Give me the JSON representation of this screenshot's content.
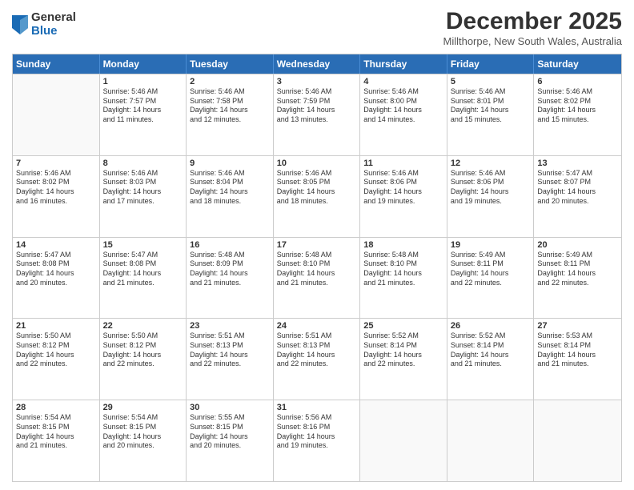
{
  "header": {
    "logo_general": "General",
    "logo_blue": "Blue",
    "title": "December 2025",
    "location": "Millthorpe, New South Wales, Australia"
  },
  "days_of_week": [
    "Sunday",
    "Monday",
    "Tuesday",
    "Wednesday",
    "Thursday",
    "Friday",
    "Saturday"
  ],
  "rows": [
    [
      {
        "day": "",
        "lines": []
      },
      {
        "day": "1",
        "lines": [
          "Sunrise: 5:46 AM",
          "Sunset: 7:57 PM",
          "Daylight: 14 hours",
          "and 11 minutes."
        ]
      },
      {
        "day": "2",
        "lines": [
          "Sunrise: 5:46 AM",
          "Sunset: 7:58 PM",
          "Daylight: 14 hours",
          "and 12 minutes."
        ]
      },
      {
        "day": "3",
        "lines": [
          "Sunrise: 5:46 AM",
          "Sunset: 7:59 PM",
          "Daylight: 14 hours",
          "and 13 minutes."
        ]
      },
      {
        "day": "4",
        "lines": [
          "Sunrise: 5:46 AM",
          "Sunset: 8:00 PM",
          "Daylight: 14 hours",
          "and 14 minutes."
        ]
      },
      {
        "day": "5",
        "lines": [
          "Sunrise: 5:46 AM",
          "Sunset: 8:01 PM",
          "Daylight: 14 hours",
          "and 15 minutes."
        ]
      },
      {
        "day": "6",
        "lines": [
          "Sunrise: 5:46 AM",
          "Sunset: 8:02 PM",
          "Daylight: 14 hours",
          "and 15 minutes."
        ]
      }
    ],
    [
      {
        "day": "7",
        "lines": [
          "Sunrise: 5:46 AM",
          "Sunset: 8:02 PM",
          "Daylight: 14 hours",
          "and 16 minutes."
        ]
      },
      {
        "day": "8",
        "lines": [
          "Sunrise: 5:46 AM",
          "Sunset: 8:03 PM",
          "Daylight: 14 hours",
          "and 17 minutes."
        ]
      },
      {
        "day": "9",
        "lines": [
          "Sunrise: 5:46 AM",
          "Sunset: 8:04 PM",
          "Daylight: 14 hours",
          "and 18 minutes."
        ]
      },
      {
        "day": "10",
        "lines": [
          "Sunrise: 5:46 AM",
          "Sunset: 8:05 PM",
          "Daylight: 14 hours",
          "and 18 minutes."
        ]
      },
      {
        "day": "11",
        "lines": [
          "Sunrise: 5:46 AM",
          "Sunset: 8:06 PM",
          "Daylight: 14 hours",
          "and 19 minutes."
        ]
      },
      {
        "day": "12",
        "lines": [
          "Sunrise: 5:46 AM",
          "Sunset: 8:06 PM",
          "Daylight: 14 hours",
          "and 19 minutes."
        ]
      },
      {
        "day": "13",
        "lines": [
          "Sunrise: 5:47 AM",
          "Sunset: 8:07 PM",
          "Daylight: 14 hours",
          "and 20 minutes."
        ]
      }
    ],
    [
      {
        "day": "14",
        "lines": [
          "Sunrise: 5:47 AM",
          "Sunset: 8:08 PM",
          "Daylight: 14 hours",
          "and 20 minutes."
        ]
      },
      {
        "day": "15",
        "lines": [
          "Sunrise: 5:47 AM",
          "Sunset: 8:08 PM",
          "Daylight: 14 hours",
          "and 21 minutes."
        ]
      },
      {
        "day": "16",
        "lines": [
          "Sunrise: 5:48 AM",
          "Sunset: 8:09 PM",
          "Daylight: 14 hours",
          "and 21 minutes."
        ]
      },
      {
        "day": "17",
        "lines": [
          "Sunrise: 5:48 AM",
          "Sunset: 8:10 PM",
          "Daylight: 14 hours",
          "and 21 minutes."
        ]
      },
      {
        "day": "18",
        "lines": [
          "Sunrise: 5:48 AM",
          "Sunset: 8:10 PM",
          "Daylight: 14 hours",
          "and 21 minutes."
        ]
      },
      {
        "day": "19",
        "lines": [
          "Sunrise: 5:49 AM",
          "Sunset: 8:11 PM",
          "Daylight: 14 hours",
          "and 22 minutes."
        ]
      },
      {
        "day": "20",
        "lines": [
          "Sunrise: 5:49 AM",
          "Sunset: 8:11 PM",
          "Daylight: 14 hours",
          "and 22 minutes."
        ]
      }
    ],
    [
      {
        "day": "21",
        "lines": [
          "Sunrise: 5:50 AM",
          "Sunset: 8:12 PM",
          "Daylight: 14 hours",
          "and 22 minutes."
        ]
      },
      {
        "day": "22",
        "lines": [
          "Sunrise: 5:50 AM",
          "Sunset: 8:12 PM",
          "Daylight: 14 hours",
          "and 22 minutes."
        ]
      },
      {
        "day": "23",
        "lines": [
          "Sunrise: 5:51 AM",
          "Sunset: 8:13 PM",
          "Daylight: 14 hours",
          "and 22 minutes."
        ]
      },
      {
        "day": "24",
        "lines": [
          "Sunrise: 5:51 AM",
          "Sunset: 8:13 PM",
          "Daylight: 14 hours",
          "and 22 minutes."
        ]
      },
      {
        "day": "25",
        "lines": [
          "Sunrise: 5:52 AM",
          "Sunset: 8:14 PM",
          "Daylight: 14 hours",
          "and 22 minutes."
        ]
      },
      {
        "day": "26",
        "lines": [
          "Sunrise: 5:52 AM",
          "Sunset: 8:14 PM",
          "Daylight: 14 hours",
          "and 21 minutes."
        ]
      },
      {
        "day": "27",
        "lines": [
          "Sunrise: 5:53 AM",
          "Sunset: 8:14 PM",
          "Daylight: 14 hours",
          "and 21 minutes."
        ]
      }
    ],
    [
      {
        "day": "28",
        "lines": [
          "Sunrise: 5:54 AM",
          "Sunset: 8:15 PM",
          "Daylight: 14 hours",
          "and 21 minutes."
        ]
      },
      {
        "day": "29",
        "lines": [
          "Sunrise: 5:54 AM",
          "Sunset: 8:15 PM",
          "Daylight: 14 hours",
          "and 20 minutes."
        ]
      },
      {
        "day": "30",
        "lines": [
          "Sunrise: 5:55 AM",
          "Sunset: 8:15 PM",
          "Daylight: 14 hours",
          "and 20 minutes."
        ]
      },
      {
        "day": "31",
        "lines": [
          "Sunrise: 5:56 AM",
          "Sunset: 8:16 PM",
          "Daylight: 14 hours",
          "and 19 minutes."
        ]
      },
      {
        "day": "",
        "lines": []
      },
      {
        "day": "",
        "lines": []
      },
      {
        "day": "",
        "lines": []
      }
    ]
  ]
}
